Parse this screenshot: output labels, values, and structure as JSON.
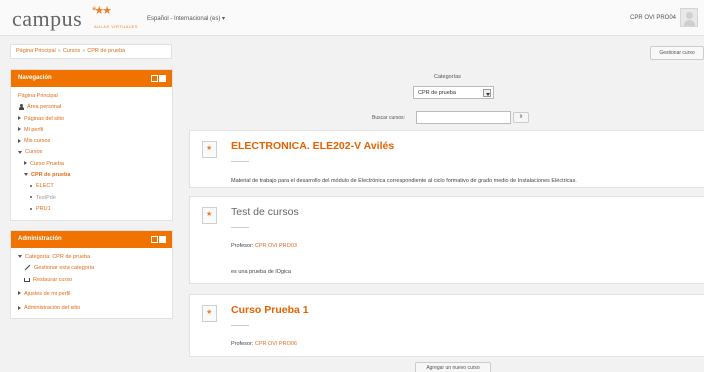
{
  "header": {
    "logo_word": "campus",
    "logo_stars": "*★★",
    "logo_sub": "AULAS VIRTUALES",
    "language": "Español - Internacional (es) ▾",
    "user_name": "CPR OVI PRO04"
  },
  "breadcrumb": {
    "items": [
      "Página Principal",
      "Cursos",
      "CPR de prueba"
    ],
    "separator": "»"
  },
  "manage_button": "Gestionar curso",
  "navigation": {
    "title": "Navegación",
    "items": {
      "home": "Página Principal",
      "dashboard": "Área personal",
      "site_pages": "Páginas del sitio",
      "my_profile": "Mi perfil",
      "my_courses": "Mis cursos",
      "courses": "Cursos",
      "curso_prueba": "Curso Prueba",
      "cpr_prueba": "CPR de prueba",
      "elect": "ELECT",
      "testpde": "TestPde",
      "pru1": "PRU1"
    }
  },
  "administration": {
    "title": "Administración",
    "items": {
      "category": "Categoría: CPR de prueba",
      "manage_category": "Gestionar esta categoría",
      "restore_course": "Restaurar curso",
      "profile_settings": "Ajustes de mi perfil",
      "site_admin": "Administración del sitio"
    }
  },
  "categories": {
    "label": "Categorías",
    "selected": "CPR de prueba"
  },
  "search": {
    "label": "Buscar cursos:",
    "button": "Ir"
  },
  "courses": [
    {
      "title": "ELECTRONICA. ELE202-V Avilés",
      "summary": "Material de trabajo para el desarrollo del módulo de Electrónica correspondiente al ciclo formativo de grado medio de Instalaciones Eléctricas."
    },
    {
      "title": "Test de cursos",
      "teacher_label": "Profesor:",
      "teacher": "CPR OVI PRO03",
      "summary": "es una prueba de lOgica"
    },
    {
      "title": "Curso Prueba 1",
      "teacher_label": "Profesor:",
      "teacher": "CPR OVI PRO06"
    }
  ],
  "add_course_button": "Agregar un nuevo curso",
  "colors": {
    "accent": "#f07300",
    "link": "#e06d1a",
    "background": "#f2f2f2"
  }
}
